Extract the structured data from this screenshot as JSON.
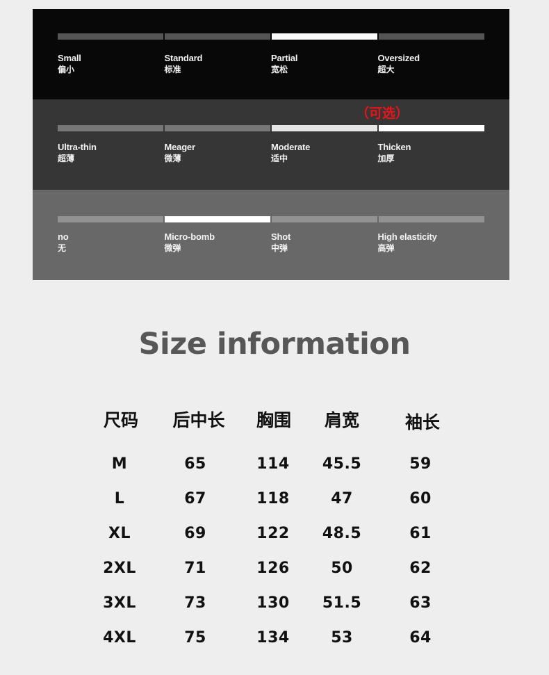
{
  "fit": {
    "options": [
      {
        "en": "Small",
        "zh": "偏小"
      },
      {
        "en": "Standard",
        "zh": "标准"
      },
      {
        "en": "Partial",
        "zh": "宽松"
      },
      {
        "en": "Oversized",
        "zh": "超大"
      }
    ],
    "selected_index": 2
  },
  "thickness": {
    "optional_note": "（可选）",
    "options": [
      {
        "en": "Ultra-thin",
        "zh": "超薄"
      },
      {
        "en": "Meager",
        "zh": "微薄"
      },
      {
        "en": "Moderate",
        "zh": "适中"
      },
      {
        "en": "Thicken",
        "zh": "加厚"
      }
    ],
    "selected_indices": [
      2,
      3
    ]
  },
  "elasticity": {
    "options": [
      {
        "en": "no",
        "zh": "无"
      },
      {
        "en": "Micro-bomb",
        "zh": "微弹"
      },
      {
        "en": "Shot",
        "zh": "中弹"
      },
      {
        "en": "High elasticity",
        "zh": "高弹"
      }
    ],
    "selected_index": 1
  },
  "size_info": {
    "title": "Size information",
    "headers": [
      "尺码",
      "后中长",
      "胸围",
      "肩宽",
      "袖长"
    ],
    "rows": [
      [
        "M",
        "65",
        "114",
        "45.5",
        "59"
      ],
      [
        "L",
        "67",
        "118",
        "47",
        "60"
      ],
      [
        "XL",
        "69",
        "122",
        "48.5",
        "61"
      ],
      [
        "2XL",
        "71",
        "126",
        "50",
        "62"
      ],
      [
        "3XL",
        "73",
        "130",
        "51.5",
        "63"
      ],
      [
        "4XL",
        "75",
        "134",
        "53",
        "64"
      ]
    ]
  }
}
